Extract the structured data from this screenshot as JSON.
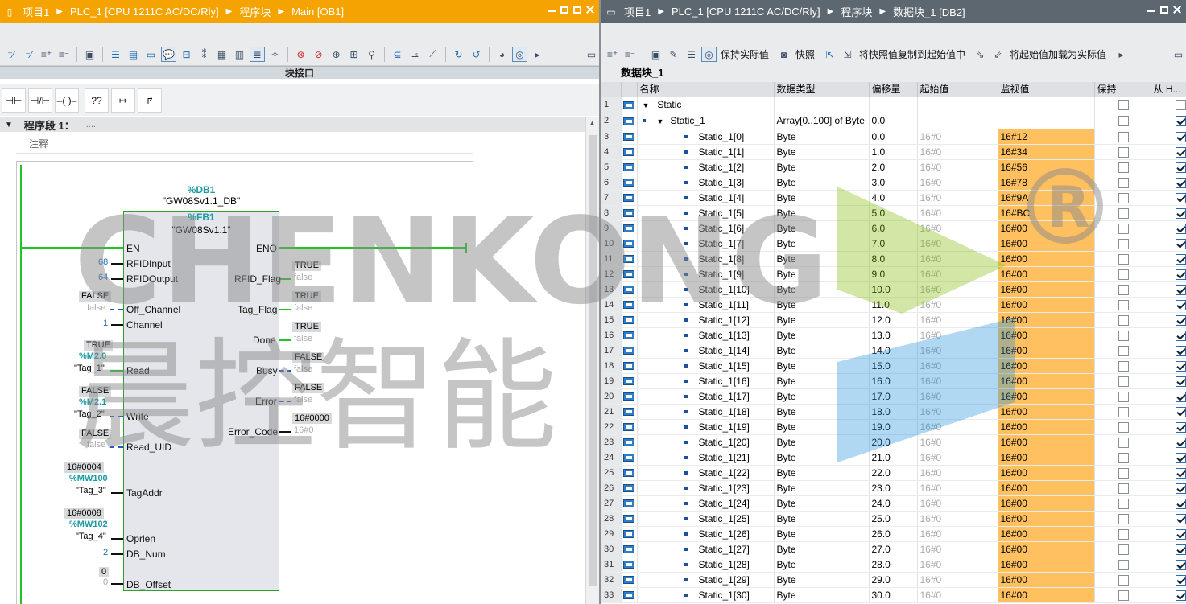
{
  "left": {
    "breadcrumb": [
      "项目1",
      "PLC_1 [CPU 1211C AC/DC/Rly]",
      "程序块",
      "Main [OB1]"
    ],
    "interface_label": "块接口",
    "segment": {
      "title": "程序段 1：",
      "dots": ".....",
      "comment": "注释"
    },
    "block": {
      "db": "%DB1",
      "db_name": "\"GW08Sv1.1_DB\"",
      "fb": "%FB1",
      "fb_name": "\"GW08Sv1.1\"",
      "inputs": {
        "en": "EN",
        "rfid_input": {
          "pin": "RFIDInput",
          "value": "68"
        },
        "rfid_output": {
          "pin": "RFIDOutput",
          "value": "64"
        },
        "off_channel": {
          "pin": "Off_Channel",
          "monitor": "FALSE",
          "value": "false"
        },
        "channel": {
          "pin": "Channel",
          "value": "1"
        },
        "read": {
          "pin": "Read",
          "monitor": "TRUE",
          "address": "%M2.0",
          "tag": "\"Tag_1\""
        },
        "write": {
          "pin": "Write",
          "monitor": "FALSE",
          "address": "%M2.1",
          "tag": "\"Tag_2\""
        },
        "read_uid": {
          "pin": "Read_UID",
          "monitor": "FALSE",
          "value": "false"
        },
        "tag_addr": {
          "pin": "TagAddr",
          "monitor": "16#0004",
          "address": "%MW100",
          "tag": "\"Tag_3\""
        },
        "oprlen": {
          "pin": "Oprlen",
          "monitor": "16#0008",
          "address": "%MW102",
          "tag": "\"Tag_4\""
        },
        "db_num": {
          "pin": "DB_Num",
          "value": "2"
        },
        "db_offset": {
          "pin": "DB_Offset",
          "monitor": "0",
          "value": "0"
        }
      },
      "outputs": {
        "eno": "ENO",
        "rfid_flag": {
          "pin": "RFID_Flag",
          "monitor": "TRUE",
          "value": "false"
        },
        "tag_flag": {
          "pin": "Tag_Flag",
          "monitor": "TRUE",
          "value": "false"
        },
        "done": {
          "pin": "Done",
          "monitor": "TRUE",
          "value": "false"
        },
        "busy": {
          "pin": "Busy",
          "monitor": "FALSE",
          "value": "false"
        },
        "error": {
          "pin": "Error",
          "monitor": "FALSE",
          "value": "false"
        },
        "error_code": {
          "pin": "Error_Code",
          "monitor": "16#0000",
          "value": "16#0"
        }
      }
    },
    "instr_buttons": [
      "⊣⊢",
      "⊣/⊢",
      "–( )–",
      "??",
      "↦",
      "↱"
    ]
  },
  "right": {
    "breadcrumb": [
      "项目1",
      "PLC_1 [CPU 1211C AC/DC/Rly]",
      "程序块",
      "数据块_1 [DB2]"
    ],
    "toolbar": {
      "keep_actual": "保持实际值",
      "snapshot": "快照",
      "copy_snapshot": "将快照值复制到起始值中",
      "load_start": "将起始值加载为实际值"
    },
    "db_title": "数据块_1",
    "columns": [
      "",
      "",
      "名称",
      "数据类型",
      "偏移量",
      "起始值",
      "监视值",
      "保持",
      "从 H..."
    ],
    "rows": [
      {
        "n": "1",
        "name": "Static",
        "type": "",
        "offset": "",
        "start": "",
        "monitor": "",
        "level": 0
      },
      {
        "n": "2",
        "name": "Static_1",
        "type": "Array[0..100] of Byte",
        "offset": "0.0",
        "start": "",
        "monitor": "",
        "level": 1
      },
      {
        "n": "3",
        "name": "Static_1[0]",
        "type": "Byte",
        "offset": "0.0",
        "start": "16#0",
        "monitor": "16#12",
        "level": 2
      },
      {
        "n": "4",
        "name": "Static_1[1]",
        "type": "Byte",
        "offset": "1.0",
        "start": "16#0",
        "monitor": "16#34",
        "level": 2
      },
      {
        "n": "5",
        "name": "Static_1[2]",
        "type": "Byte",
        "offset": "2.0",
        "start": "16#0",
        "monitor": "16#56",
        "level": 2
      },
      {
        "n": "6",
        "name": "Static_1[3]",
        "type": "Byte",
        "offset": "3.0",
        "start": "16#0",
        "monitor": "16#78",
        "level": 2
      },
      {
        "n": "7",
        "name": "Static_1[4]",
        "type": "Byte",
        "offset": "4.0",
        "start": "16#0",
        "monitor": "16#9A",
        "level": 2
      },
      {
        "n": "8",
        "name": "Static_1[5]",
        "type": "Byte",
        "offset": "5.0",
        "start": "16#0",
        "monitor": "16#BC",
        "level": 2
      },
      {
        "n": "9",
        "name": "Static_1[6]",
        "type": "Byte",
        "offset": "6.0",
        "start": "16#0",
        "monitor": "16#00",
        "level": 2
      },
      {
        "n": "10",
        "name": "Static_1[7]",
        "type": "Byte",
        "offset": "7.0",
        "start": "16#0",
        "monitor": "16#00",
        "level": 2
      },
      {
        "n": "11",
        "name": "Static_1[8]",
        "type": "Byte",
        "offset": "8.0",
        "start": "16#0",
        "monitor": "16#00",
        "level": 2
      },
      {
        "n": "12",
        "name": "Static_1[9]",
        "type": "Byte",
        "offset": "9.0",
        "start": "16#0",
        "monitor": "16#00",
        "level": 2
      },
      {
        "n": "13",
        "name": "Static_1[10]",
        "type": "Byte",
        "offset": "10.0",
        "start": "16#0",
        "monitor": "16#00",
        "level": 2
      },
      {
        "n": "14",
        "name": "Static_1[11]",
        "type": "Byte",
        "offset": "11.0",
        "start": "16#0",
        "monitor": "16#00",
        "level": 2
      },
      {
        "n": "15",
        "name": "Static_1[12]",
        "type": "Byte",
        "offset": "12.0",
        "start": "16#0",
        "monitor": "16#00",
        "level": 2
      },
      {
        "n": "16",
        "name": "Static_1[13]",
        "type": "Byte",
        "offset": "13.0",
        "start": "16#0",
        "monitor": "16#00",
        "level": 2
      },
      {
        "n": "17",
        "name": "Static_1[14]",
        "type": "Byte",
        "offset": "14.0",
        "start": "16#0",
        "monitor": "16#00",
        "level": 2
      },
      {
        "n": "18",
        "name": "Static_1[15]",
        "type": "Byte",
        "offset": "15.0",
        "start": "16#0",
        "monitor": "16#00",
        "level": 2
      },
      {
        "n": "19",
        "name": "Static_1[16]",
        "type": "Byte",
        "offset": "16.0",
        "start": "16#0",
        "monitor": "16#00",
        "level": 2
      },
      {
        "n": "20",
        "name": "Static_1[17]",
        "type": "Byte",
        "offset": "17.0",
        "start": "16#0",
        "monitor": "16#00",
        "level": 2
      },
      {
        "n": "21",
        "name": "Static_1[18]",
        "type": "Byte",
        "offset": "18.0",
        "start": "16#0",
        "monitor": "16#00",
        "level": 2
      },
      {
        "n": "22",
        "name": "Static_1[19]",
        "type": "Byte",
        "offset": "19.0",
        "start": "16#0",
        "monitor": "16#00",
        "level": 2
      },
      {
        "n": "23",
        "name": "Static_1[20]",
        "type": "Byte",
        "offset": "20.0",
        "start": "16#0",
        "monitor": "16#00",
        "level": 2
      },
      {
        "n": "24",
        "name": "Static_1[21]",
        "type": "Byte",
        "offset": "21.0",
        "start": "16#0",
        "monitor": "16#00",
        "level": 2
      },
      {
        "n": "25",
        "name": "Static_1[22]",
        "type": "Byte",
        "offset": "22.0",
        "start": "16#0",
        "monitor": "16#00",
        "level": 2
      },
      {
        "n": "26",
        "name": "Static_1[23]",
        "type": "Byte",
        "offset": "23.0",
        "start": "16#0",
        "monitor": "16#00",
        "level": 2
      },
      {
        "n": "27",
        "name": "Static_1[24]",
        "type": "Byte",
        "offset": "24.0",
        "start": "16#0",
        "monitor": "16#00",
        "level": 2
      },
      {
        "n": "28",
        "name": "Static_1[25]",
        "type": "Byte",
        "offset": "25.0",
        "start": "16#0",
        "monitor": "16#00",
        "level": 2
      },
      {
        "n": "29",
        "name": "Static_1[26]",
        "type": "Byte",
        "offset": "26.0",
        "start": "16#0",
        "monitor": "16#00",
        "level": 2
      },
      {
        "n": "30",
        "name": "Static_1[27]",
        "type": "Byte",
        "offset": "27.0",
        "start": "16#0",
        "monitor": "16#00",
        "level": 2
      },
      {
        "n": "31",
        "name": "Static_1[28]",
        "type": "Byte",
        "offset": "28.0",
        "start": "16#0",
        "monitor": "16#00",
        "level": 2
      },
      {
        "n": "32",
        "name": "Static_1[29]",
        "type": "Byte",
        "offset": "29.0",
        "start": "16#0",
        "monitor": "16#00",
        "level": 2
      },
      {
        "n": "33",
        "name": "Static_1[30]",
        "type": "Byte",
        "offset": "30.0",
        "start": "16#0",
        "monitor": "16#00",
        "level": 2
      }
    ]
  },
  "watermark": {
    "latin": "CHENKONG",
    "cn": "晨控智能",
    "mark": "®"
  },
  "colors": {
    "title_orange": "#f5a300",
    "title_gray": "#5d6770",
    "rail_green": "#22c422",
    "monitor_orange": "#ffc060",
    "teal": "#1d9ba3"
  }
}
